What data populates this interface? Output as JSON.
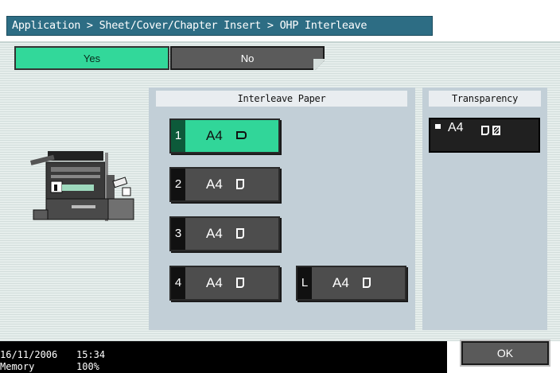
{
  "breadcrumb": {
    "text": "Application > Sheet/Cover/Chapter Insert > OHP Interleave"
  },
  "toggle": {
    "yes_label": "Yes",
    "no_label": "No",
    "selected": "Yes"
  },
  "interleave": {
    "title": "Interleave Paper",
    "trays": [
      {
        "number": "1",
        "size": "A4",
        "orientation": "landscape",
        "selected": true
      },
      {
        "number": "2",
        "size": "A4",
        "orientation": "portrait",
        "selected": false
      },
      {
        "number": "3",
        "size": "A4",
        "orientation": "portrait",
        "selected": false
      },
      {
        "number": "4",
        "size": "A4",
        "orientation": "portrait",
        "selected": false
      },
      {
        "number": "L",
        "size": "A4",
        "orientation": "portrait",
        "selected": false
      }
    ]
  },
  "transparency": {
    "title": "Transparency",
    "size": "A4"
  },
  "status": {
    "date": "16/11/2006",
    "time": "15:34",
    "memory_label": "Memory",
    "memory_value": "100%"
  },
  "ok_label": "OK",
  "colors": {
    "titlebar": "#2d6d84",
    "selected": "#32d89a",
    "button": "#5b5b5b",
    "panel": "#c2cfd7"
  }
}
